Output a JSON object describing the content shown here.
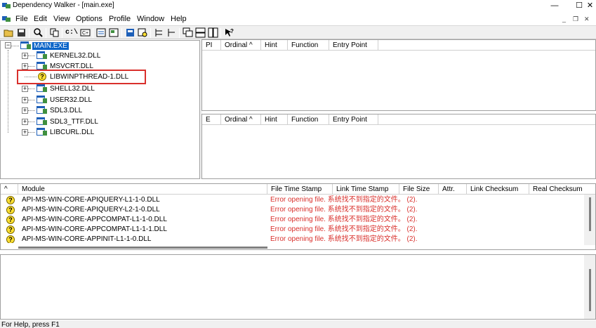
{
  "window": {
    "title": "Dependency Walker - [main.exe]",
    "controls": {
      "minimize": "—",
      "maximize": "☐",
      "close": "✕"
    }
  },
  "menubar": {
    "items": [
      "File",
      "Edit",
      "View",
      "Options",
      "Profile",
      "Window",
      "Help"
    ],
    "mdi_controls": {
      "minimize": "_",
      "restore": "❐",
      "close": "✕"
    }
  },
  "toolbar": {
    "buttons": [
      "open-icon",
      "save-icon",
      "find-icon",
      "copy-icon",
      "full-paths-icon",
      "undecorate-icon",
      "properties-icon",
      "view-module-icon",
      "highlight-icon",
      "expand-icon",
      "collapse-icon",
      "tile-icon",
      "cascade-icon",
      "help-icon"
    ],
    "cmd_label": "c:\\"
  },
  "tree": {
    "root": "MAIN.EXE",
    "children": [
      {
        "label": "KERNEL32.DLL",
        "expandable": true,
        "status": "ok"
      },
      {
        "label": "MSVCRT.DLL",
        "expandable": true,
        "status": "ok"
      },
      {
        "label": "LIBWINPTHREAD-1.DLL",
        "expandable": false,
        "status": "missing"
      },
      {
        "label": "SHELL32.DLL",
        "expandable": true,
        "status": "ok"
      },
      {
        "label": "USER32.DLL",
        "expandable": true,
        "status": "ok"
      },
      {
        "label": "SDL3.DLL",
        "expandable": true,
        "status": "ok"
      },
      {
        "label": "SDL3_TTF.DLL",
        "expandable": true,
        "status": "ok"
      },
      {
        "label": "LIBCURL.DLL",
        "expandable": true,
        "status": "ok"
      }
    ]
  },
  "imports": {
    "columns": [
      "PI",
      "Ordinal ^",
      "Hint",
      "Function",
      "Entry Point"
    ]
  },
  "exports": {
    "columns": [
      "E",
      "Ordinal ^",
      "Hint",
      "Function",
      "Entry Point"
    ]
  },
  "modules": {
    "columns": [
      "^",
      "Module",
      "File Time Stamp",
      "Link Time Stamp",
      "File Size",
      "Attr.",
      "Link Checksum",
      "Real Checksum"
    ],
    "rows": [
      {
        "module": "API-MS-WIN-CORE-APIQUERY-L1-1-0.DLL",
        "error": "Error opening file. 系统找不到指定的文件。 (2)."
      },
      {
        "module": "API-MS-WIN-CORE-APIQUERY-L2-1-0.DLL",
        "error": "Error opening file. 系统找不到指定的文件。 (2)."
      },
      {
        "module": "API-MS-WIN-CORE-APPCOMPAT-L1-1-0.DLL",
        "error": "Error opening file. 系统找不到指定的文件。 (2)."
      },
      {
        "module": "API-MS-WIN-CORE-APPCOMPAT-L1-1-1.DLL",
        "error": "Error opening file. 系统找不到指定的文件。 (2)."
      },
      {
        "module": "API-MS-WIN-CORE-APPINIT-L1-1-0.DLL",
        "error": "Error opening file. 系统找不到指定的文件。 (2)."
      }
    ],
    "row_icon": "?"
  },
  "status": {
    "text": "For Help, press F1"
  },
  "colors": {
    "selection": "#0a64c8",
    "error": "#d9302c",
    "highlight_box": "#d9302c",
    "warning_icon": "#ffe033"
  }
}
